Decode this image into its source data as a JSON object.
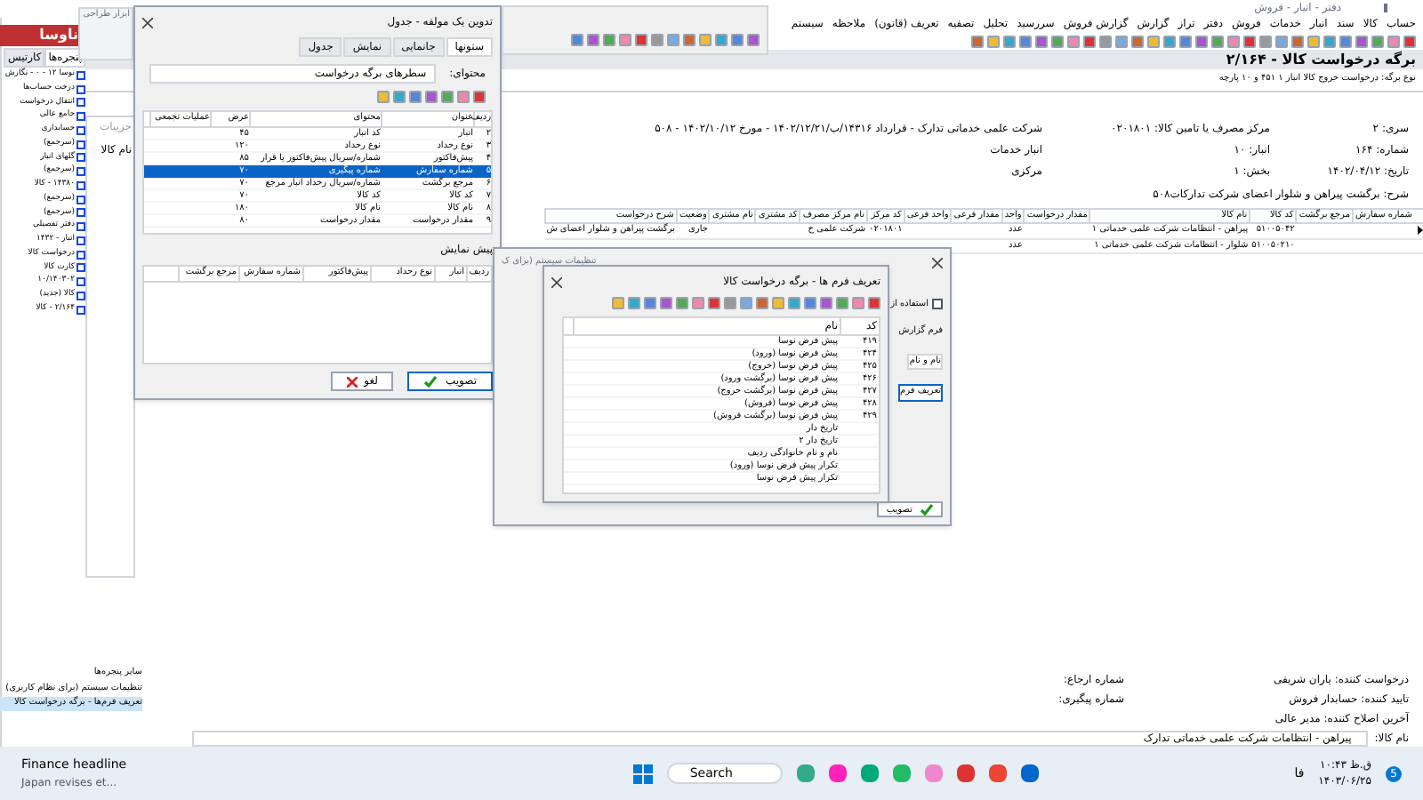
{
  "app_title": "دفتر - انبار - فروش",
  "design_tools": {
    "title": "ابزار طراحی"
  },
  "menu": [
    "حساب",
    "کالا",
    "سند",
    "انبار",
    "خدمات",
    "فروش",
    "دفتر",
    "تراز",
    "گزارش",
    "گزارش فروش",
    "سررسید",
    "تحلیل",
    "تصفیه",
    "تعریف (قانون)",
    "ملاحظه",
    "سیستم"
  ],
  "document": {
    "title": "برگه درخواست کالا - ۲/۱۶۴",
    "subtitle": "نوع برگه: درخواست خروج کالا انبار ۱ ۴۵۱ و ۱۰ پارچه",
    "fields_right": [
      {
        "label": "سری:",
        "value": "۲"
      },
      {
        "label": "شماره:",
        "value": "۱۶۴"
      },
      {
        "label": "تاریخ:",
        "value": "۱۴۰۲/۰۴/۱۲"
      }
    ],
    "fields_mid": [
      {
        "label": "مرکز مصرف یا تامین کالا:",
        "value": "۰۲۰۱۸۰۱"
      },
      {
        "label": "انبار:",
        "value": "۱۰"
      },
      {
        "label": "بخش:",
        "value": "۱"
      }
    ],
    "fields_left": [
      "شرکت علمی خدماتی تدارک - قرارداد ۱۴۳۱۶/ب/۱۴۰۲/۱۲/۲۱ - مورخ ۱۴۰۲/۱۰/۱۲ - ۵۰۸",
      "انبار خدمات",
      "مرکزی"
    ],
    "description": {
      "label": "شرح:",
      "value": "برگشت پیراهن و شلوار اعضای شرکت تدارکات۵۰۸"
    }
  },
  "table": {
    "columns": [
      "شماره سفارش",
      "مرجع برگشت",
      "کد کالا",
      "نام کالا",
      "مقدار درخواست",
      "واحد",
      "مقدار فرعی",
      "واحد فرعی",
      "کد مرکز",
      "نام مرکز مصرف",
      "کد مشتری",
      "نام مشتری",
      "وضعیت",
      "شرح درخواست"
    ],
    "rows": [
      {
        "current": true,
        "cells": [
          "",
          "",
          "۵۱۰۰۵۰۴۲",
          "پیراهن - انتظامات شرکت علمی خدماتی ۱",
          "",
          "عدد",
          "",
          "",
          "۰۲۰۱۸۰۱",
          "شرکت علمی خ",
          "",
          "",
          "جاری",
          "برگشت پیراهن و شلوار اعضای ش"
        ]
      },
      {
        "current": false,
        "cells": [
          "",
          "",
          "۵۱۰۰۵۰۲۱۰",
          "شلوار - انتظامات شرکت علمی خدماتی ۱",
          "",
          "عدد",
          "",
          "",
          "",
          "",
          "",
          "",
          "",
          ""
        ]
      }
    ]
  },
  "footer_fields": [
    {
      "label": "درخواست کننده:",
      "value": "یاران شریفی"
    },
    {
      "label": "تایید کننده:",
      "value": "حسابدار فروش"
    },
    {
      "label": "آخرین اصلاح کننده:",
      "value": "مدیر عالی"
    }
  ],
  "footer_refs": [
    "شماره ارجاع:",
    "شماره پیگیری:"
  ],
  "item_name": {
    "label": "نام کالا:",
    "value": "پیراهن - انتظامات شرکت علمی خدماتی تدارک"
  },
  "sidebar": {
    "logo": "ناوسا",
    "tabs": [
      {
        "label": "پنجره‌ها",
        "selected": true
      },
      {
        "label": "کارتیس",
        "selected": false
      }
    ],
    "items": [
      "نوسا ۱۲ - ۰ - نگارش",
      "درخت حساب‌ها",
      "انتقال درخواست",
      "جامع عالی",
      "حسابداری",
      "(سرجمع)",
      "گلهای انبار",
      "(سرجمع)",
      "۱۴۳۸۰ - کالا",
      "(سرجمع)",
      "(سرجمع)",
      "دفتر تفصیلی",
      "انبار - ۱۴۳۲",
      "درخواست کالا",
      "کارت کالا",
      "۱۰/۱۴۰۳۰۲",
      "کالا (جدید)",
      "۲/۱۶۴ - کالا"
    ],
    "other_title": "سایر پنجره‌ها",
    "other_items": [
      {
        "label": "تنظیمات سیستم (برای نظام کاربری)",
        "selected": false
      },
      {
        "label": "تعریف فرم‌ها - برگه درخواست کالا",
        "selected": true
      }
    ]
  },
  "details_panel": {
    "title": "جزییات",
    "field": "نام کالا"
  },
  "component_dialog": {
    "title": "تدوین یک مولفه - جدول",
    "tabs": [
      {
        "label": "ستونها",
        "selected": true
      },
      {
        "label": "جانمایی",
        "selected": false
      },
      {
        "label": "نمایش",
        "selected": false
      },
      {
        "label": "جدول",
        "selected": false
      }
    ],
    "content_label": "محتوای:",
    "content_value": "سطرهای برگه درخواست",
    "columns": [
      "ردیف",
      "عنوان",
      "محتوای",
      "عرض",
      "عملیات تجمعی"
    ],
    "rows": [
      {
        "selected": false,
        "cells": [
          "۲",
          "انبار",
          "کد انبار",
          "۴۵",
          ""
        ]
      },
      {
        "selected": false,
        "cells": [
          "۳",
          "نوع رخداد",
          "نوع رخداد",
          "۱۲۰",
          ""
        ]
      },
      {
        "selected": false,
        "cells": [
          "۴",
          "پیش‌فاکتور",
          "شماره/سریال پیش‌فاکتور یا قرار",
          "۸۵",
          ""
        ]
      },
      {
        "selected": true,
        "cells": [
          "۵",
          "شماره سفارش",
          "شماره پیگیری",
          "۷۰",
          ""
        ]
      },
      {
        "selected": false,
        "cells": [
          "۶",
          "مرجع برگشت",
          "شماره/سریال رخداد انبار مرجع",
          "۷۰",
          ""
        ]
      },
      {
        "selected": false,
        "cells": [
          "۷",
          "کد کالا",
          "کد کالا",
          "۷۰",
          ""
        ]
      },
      {
        "selected": false,
        "cells": [
          "۸",
          "نام کالا",
          "نام کالا",
          "۱۸۰",
          ""
        ]
      },
      {
        "selected": false,
        "cells": [
          "۹",
          "مقدار درخواست",
          "مقدار درخواست",
          "۸۰",
          ""
        ]
      }
    ],
    "preview_label": "پیش نمایش",
    "preview_columns": [
      "ردیف",
      "انبار",
      "نوع رخداد",
      "پیش‌فاکتور",
      "شماره سفارش",
      "مرجع برگشت"
    ],
    "buttons": [
      "تصویب",
      "لغو"
    ]
  },
  "settings_dialog": {
    "title": "تنظیمات سیستم (برای ک",
    "checkbox": {
      "label": "استفاده از",
      "checked": false
    },
    "report_label": "فرم گزارش",
    "report_value": "نام و نام",
    "define_button": "تعریف فرم",
    "ok_button": "تصویب"
  },
  "forms_dialog": {
    "title": "تعریف فرم ها - برگه درخواست کالا",
    "columns": [
      "کد",
      "نام"
    ],
    "rows": [
      [
        "۴۱۹",
        "پیش فرض نوسا"
      ],
      [
        "۴۲۴",
        "پیش فرض نوسا (ورود)"
      ],
      [
        "۴۲۵",
        "پیش فرض نوسا (خروج)"
      ],
      [
        "۴۲۶",
        "پیش فرض نوسا (برگشت ورود)"
      ],
      [
        "۴۲۷",
        "پیش فرض نوسا (برگشت خروج)"
      ],
      [
        "۴۲۸",
        "پیش فرض نوسا (فروش)"
      ],
      [
        "۴۲۹",
        "پیش فرض نوسا (برگشت فروش)"
      ],
      [
        "",
        "تاریخ دار"
      ],
      [
        "",
        "تاریخ دار ۲"
      ],
      [
        "",
        "نام و نام خانوادگی ردیف"
      ],
      [
        "",
        "تکرار پیش فرض نوسا (ورود)"
      ],
      [
        "",
        "تکرار پیش فرض نوسا"
      ]
    ]
  },
  "taskbar": {
    "news_title": "Finance headline",
    "news_text": "Japan revises et...",
    "search": "Search",
    "language": "فا",
    "time": "۱۰:۴۳ ق.ظ",
    "date": "۱۴۰۳/۰۶/۲۵",
    "badge": "5"
  }
}
